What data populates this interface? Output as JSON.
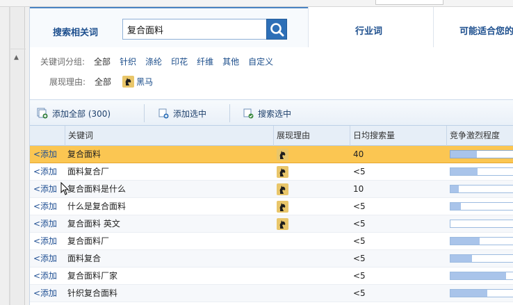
{
  "tabs": {
    "search_label": "搜索相关词",
    "search_value": "复合面料",
    "industry_label": "行业词",
    "maybe_label": "可能适合您的"
  },
  "filters": {
    "group_label": "关键词分组:",
    "group_options": [
      "全部",
      "针织",
      "涤纶",
      "印花",
      "纤维",
      "其他",
      "自定义"
    ],
    "reason_label": "展现理由:",
    "reason_all": "全部",
    "reason_dark_horse": "黑马"
  },
  "toolbar": {
    "add_all": "添加全部 (300)",
    "add_selected": "添加选中",
    "search_selected": "搜索选中"
  },
  "table": {
    "headers": {
      "keyword": "关键词",
      "reason": "展现理由",
      "volume": "日均搜索量",
      "competition": "竞争激烈程度"
    },
    "add_label": "<添加",
    "rows": [
      {
        "keyword": "复合面料",
        "dark_horse": true,
        "volume": "40",
        "competition": 0.42
      },
      {
        "keyword": "面料复合厂",
        "dark_horse": true,
        "volume": "<5",
        "competition": 0.43
      },
      {
        "keyword": "复合面料是什么",
        "dark_horse": true,
        "volume": "10",
        "competition": 0.13
      },
      {
        "keyword": "什么是复合面料",
        "dark_horse": true,
        "volume": "<5",
        "competition": 0.16
      },
      {
        "keyword": "复合面料 英文",
        "dark_horse": true,
        "volume": "<5",
        "competition": 0.0
      },
      {
        "keyword": "复合面料厂",
        "dark_horse": false,
        "volume": "<5",
        "competition": 0.46
      },
      {
        "keyword": "面料复合",
        "dark_horse": false,
        "volume": "<5",
        "competition": 0.34
      },
      {
        "keyword": "复合面料厂家",
        "dark_horse": false,
        "volume": "<5",
        "competition": 0.88
      },
      {
        "keyword": "针织复合面料",
        "dark_horse": false,
        "volume": "<5",
        "competition": 0.58
      }
    ]
  }
}
